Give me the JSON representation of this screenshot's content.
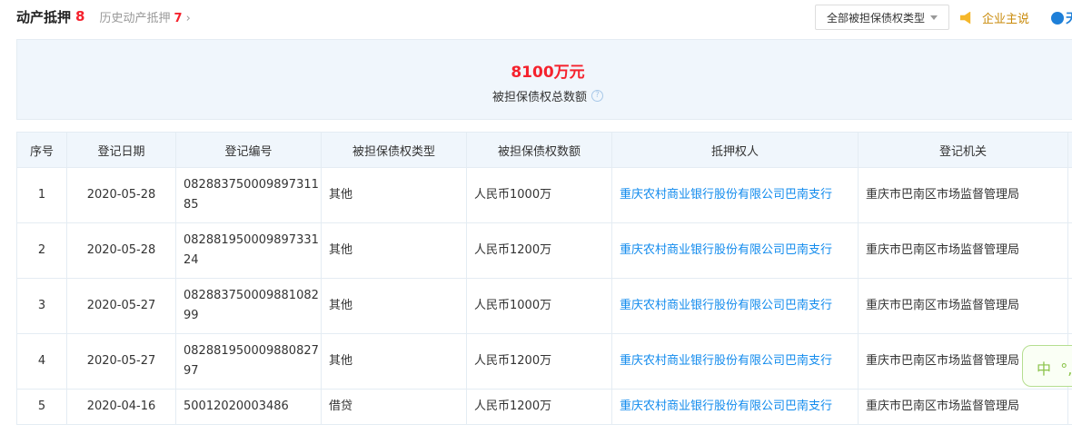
{
  "header": {
    "title": "动产抵押",
    "count": "8",
    "history_label": "历史动产抵押",
    "history_count": "7",
    "chevron": "›"
  },
  "filter": {
    "selected": "全部被担保债权类型"
  },
  "enterprise_say": "企业主说",
  "brand_partial": "天",
  "summary": {
    "amount": "8100万元",
    "label": "被担保债权总数额",
    "help": "?"
  },
  "table": {
    "columns": [
      "序号",
      "登记日期",
      "登记编号",
      "被担保债权类型",
      "被担保债权数额",
      "抵押权人",
      "登记机关"
    ],
    "rows": [
      {
        "no": "1",
        "date": "2020-05-28",
        "reg": "082883750009897311 85",
        "type": "其他",
        "amount": "人民币1000万",
        "holder": "重庆农村商业银行股份有限公司巴南支行",
        "authority": "重庆市巴南区市场监督管理局"
      },
      {
        "no": "2",
        "date": "2020-05-28",
        "reg": "082881950009897331 24",
        "type": "其他",
        "amount": "人民币1200万",
        "holder": "重庆农村商业银行股份有限公司巴南支行",
        "authority": "重庆市巴南区市场监督管理局"
      },
      {
        "no": "3",
        "date": "2020-05-27",
        "reg": "082883750009881082 99",
        "type": "其他",
        "amount": "人民币1000万",
        "holder": "重庆农村商业银行股份有限公司巴南支行",
        "authority": "重庆市巴南区市场监督管理局"
      },
      {
        "no": "4",
        "date": "2020-05-27",
        "reg": "082881950009880827 97",
        "type": "其他",
        "amount": "人民币1200万",
        "holder": "重庆农村商业银行股份有限公司巴南支行",
        "authority": "重庆市巴南区市场监督管理局"
      },
      {
        "no": "5",
        "date": "2020-04-16",
        "reg": "50012020003486",
        "type": "借贷",
        "amount": "人民币1200万",
        "holder": "重庆农村商业银行股份有限公司巴南支行",
        "authority": "重庆市巴南区市场监督管理局"
      }
    ]
  },
  "ime": {
    "mode": "中",
    "punct": "°,"
  },
  "colors": {
    "accent": "#128bed",
    "count": "#f5222d",
    "say": "#c98a0a"
  }
}
